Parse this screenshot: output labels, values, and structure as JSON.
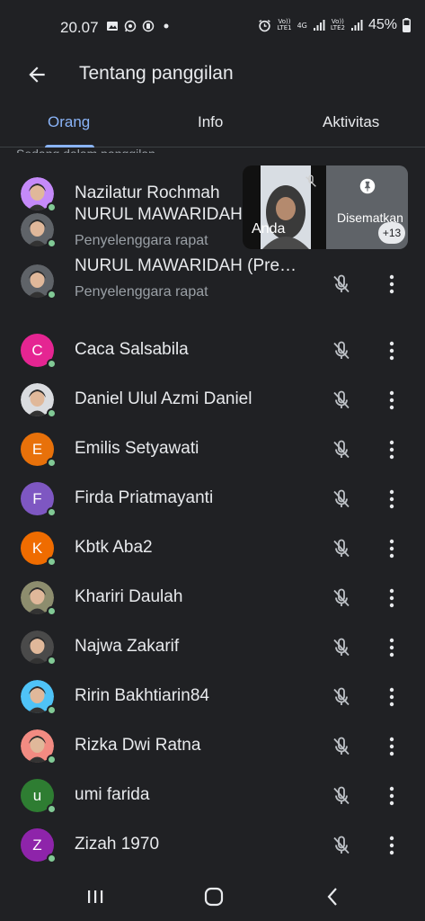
{
  "status_bar": {
    "time": "20.07",
    "battery": "45%",
    "sim1_label": "LTE1",
    "sim2_label": "LTE2",
    "network": "4G",
    "volte": "Vo))"
  },
  "header": {
    "title": "Tentang panggilan"
  },
  "tabs": [
    {
      "label": "Orang",
      "active": true
    },
    {
      "label": "Info",
      "active": false
    },
    {
      "label": "Aktivitas",
      "active": false
    }
  ],
  "section_label": "Sedang dalam panggilan",
  "pip": {
    "self_label": "Anda",
    "pinned_label": "Disematkan",
    "more_count": "+13"
  },
  "participants": [
    {
      "name": "Nazilatur Rochmah",
      "role": "",
      "avatar": "photo",
      "initial": "",
      "color": "#c58af9"
    },
    {
      "name": "NURUL MAWARIDAH",
      "role": "Penyelenggara rapat",
      "avatar": "photo",
      "initial": "",
      "color": "#5f6368"
    },
    {
      "name": "NURUL MAWARIDAH (Pre…",
      "role": "Penyelenggara rapat",
      "avatar": "photo",
      "initial": "",
      "color": "#5f6368"
    },
    {
      "name": "Caca Salsabila",
      "role": "",
      "avatar": "letter",
      "initial": "C",
      "color": "#e52592"
    },
    {
      "name": "Daniel Ulul Azmi Daniel",
      "role": "",
      "avatar": "photo",
      "initial": "",
      "color": "#dadce0"
    },
    {
      "name": "Emilis Setyawati",
      "role": "",
      "avatar": "letter",
      "initial": "E",
      "color": "#e8710a"
    },
    {
      "name": "Firda Priatmayanti",
      "role": "",
      "avatar": "letter",
      "initial": "F",
      "color": "#7e57c2"
    },
    {
      "name": "Kbtk Aba2",
      "role": "",
      "avatar": "letter",
      "initial": "K",
      "color": "#ef6c00"
    },
    {
      "name": "Khariri Daulah",
      "role": "",
      "avatar": "photo",
      "initial": "",
      "color": "#8d8d6e"
    },
    {
      "name": "Najwa Zakarif",
      "role": "",
      "avatar": "photo",
      "initial": "",
      "color": "#4a4a4a"
    },
    {
      "name": "Ririn Bakhtiarin84",
      "role": "",
      "avatar": "photo",
      "initial": "",
      "color": "#4fc3f7"
    },
    {
      "name": "Rizka Dwi Ratna",
      "role": "",
      "avatar": "photo",
      "initial": "",
      "color": "#f28b82"
    },
    {
      "name": "umi farida",
      "role": "",
      "avatar": "letter",
      "initial": "u",
      "color": "#2e7d32"
    },
    {
      "name": "Zizah 1970",
      "role": "",
      "avatar": "letter",
      "initial": "Z",
      "color": "#8e24aa"
    }
  ],
  "icons": {
    "back": "arrow-back-icon",
    "mic_off": "mic-off-icon",
    "more": "more-vert-icon",
    "pin": "pin-icon",
    "nav_recents": "recents-icon",
    "nav_home": "home-icon",
    "nav_back": "nav-back-icon"
  },
  "colors": {
    "background": "#202124",
    "accent": "#8ab4f8",
    "online": "#81c995"
  }
}
